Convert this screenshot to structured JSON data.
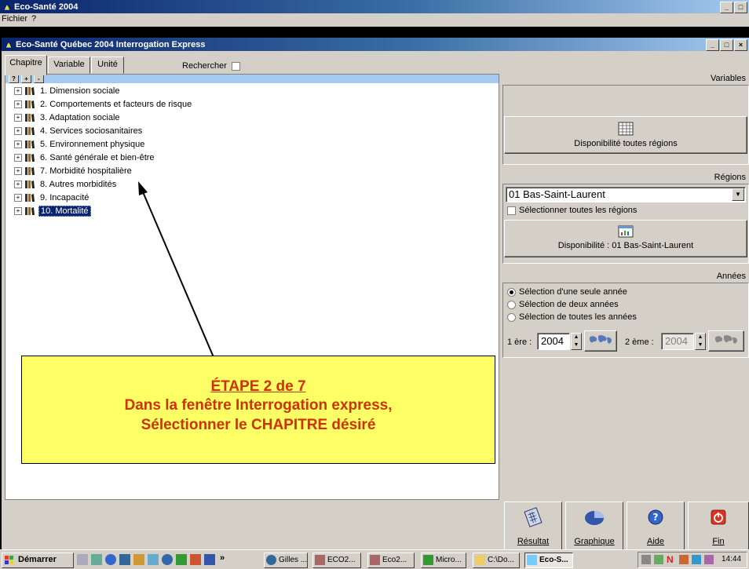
{
  "outer_window": {
    "title": "Eco-Santé 2004",
    "menu": [
      "Fichier",
      "?"
    ]
  },
  "inner_window": {
    "title": "Eco-Santé Québec 2004   Interrogation Express"
  },
  "tabs": [
    {
      "label": "Chapitre",
      "active": true
    },
    {
      "label": "Variable",
      "active": false
    },
    {
      "label": "Unité",
      "active": false
    }
  ],
  "search": {
    "label": "Rechercher",
    "checked": false
  },
  "tree_toolbar": [
    "?",
    "+",
    "-"
  ],
  "chapters": [
    {
      "label": "1. Dimension sociale",
      "selected": false
    },
    {
      "label": "2. Comportements et facteurs de risque",
      "selected": false
    },
    {
      "label": "3. Adaptation sociale",
      "selected": false
    },
    {
      "label": "4. Services sociosanitaires",
      "selected": false
    },
    {
      "label": "5. Environnement physique",
      "selected": false
    },
    {
      "label": "6. Santé générale et bien-être",
      "selected": false
    },
    {
      "label": "7. Morbidité hospitalière",
      "selected": false
    },
    {
      "label": "8. Autres morbidités",
      "selected": false
    },
    {
      "label": "9. Incapacité",
      "selected": false
    },
    {
      "label": "10. Mortalité",
      "selected": true
    }
  ],
  "right": {
    "variables_label": "Variables",
    "availability_all_button": "Disponibilité toutes régions",
    "regions_label": "Régions",
    "region_selected": "01 Bas-Saint-Laurent",
    "select_all_regions_label": "Sélectionner toutes les régions",
    "select_all_regions_checked": false,
    "availability_region_button": "Disponibilité : 01 Bas-Saint-Laurent",
    "years_label": "Années",
    "year_options": [
      {
        "label": "Sélection d'une seule année",
        "checked": true
      },
      {
        "label": "Sélection de deux années",
        "checked": false
      },
      {
        "label": "Sélection de toutes les années",
        "checked": false
      }
    ],
    "first_year_label": "1 ère :",
    "first_year_value": "2004",
    "second_year_label": "2 ème :",
    "second_year_value": "2004"
  },
  "bottom_buttons": [
    "Résultat",
    "Graphique",
    "Aide",
    "Fin"
  ],
  "callout": {
    "line1": "ÉTAPE 2 de 7",
    "line2": "Dans la fenêtre Interrogation express,",
    "line3": "Sélectionner le CHAPITRE désiré"
  },
  "taskbar": {
    "start_label": "Démarrer",
    "items": [
      "Gilles ...",
      "ECO2...",
      "Eco2...",
      "Micro...",
      "C:\\Do...",
      "Eco-S..."
    ],
    "clock": "14:44"
  },
  "colors": {
    "callout_bg": "#ffff66",
    "callout_text": "#cc3300",
    "selection": "#0a246a",
    "title_gradient_start": "#0a246a"
  }
}
